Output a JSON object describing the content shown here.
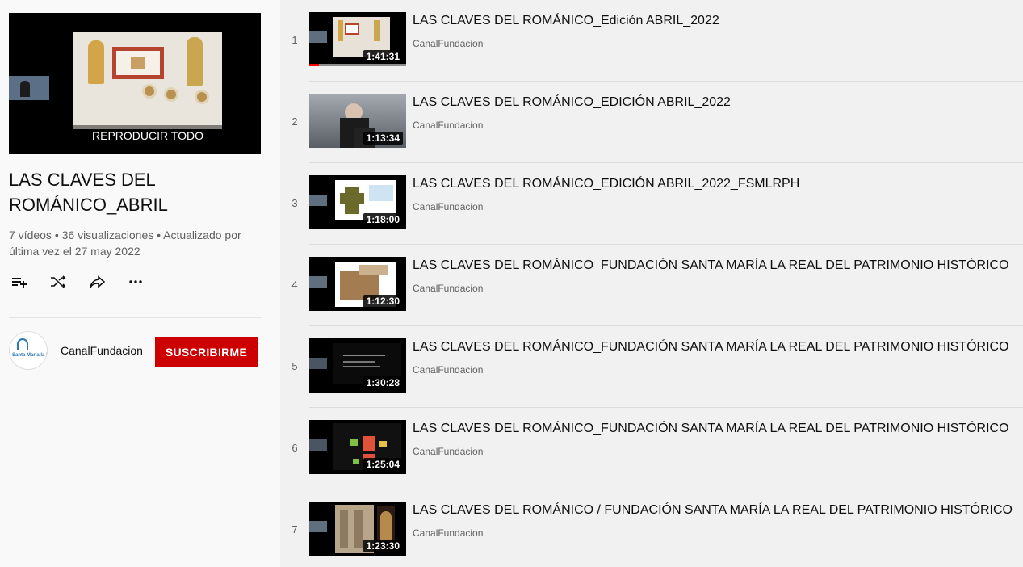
{
  "playlist": {
    "play_all_label": "REPRODUCIR TODO",
    "title": "LAS CLAVES DEL ROMÁNICO_ABRIL",
    "meta": "7 vídeos • 36 visualizaciones • Actualizado por última vez el 27 may 2022",
    "actions": [
      "add-to-queue-icon",
      "shuffle-icon",
      "share-icon",
      "more-icon"
    ],
    "owner": {
      "name": "CanalFundacion",
      "avatar_text": "Santa María la Real",
      "subscribe_label": "SUSCRIBIRME"
    }
  },
  "videos": [
    {
      "index": "1",
      "title": "LAS CLAVES DEL ROMÁNICO_Edición ABRIL_2022",
      "channel": "CanalFundacion",
      "duration": "1:41:31",
      "watched_fraction": 0.1
    },
    {
      "index": "2",
      "title": "LAS CLAVES DEL ROMÁNICO_EDICIÓN ABRIL_2022",
      "channel": "CanalFundacion",
      "duration": "1:13:34"
    },
    {
      "index": "3",
      "title": "LAS CLAVES DEL ROMÁNICO_EDICIÓN ABRIL_2022_FSMLRPH",
      "channel": "CanalFundacion",
      "duration": "1:18:00"
    },
    {
      "index": "4",
      "title": "LAS CLAVES DEL ROMÁNICO_FUNDACIÓN SANTA MARÍA LA REAL DEL PATRIMONIO HISTÓRICO",
      "channel": "CanalFundacion",
      "duration": "1:12:30"
    },
    {
      "index": "5",
      "title": "LAS CLAVES DEL ROMÁNICO_FUNDACIÓN SANTA MARÍA LA REAL DEL PATRIMONIO HISTÓRICO",
      "channel": "CanalFundacion",
      "duration": "1:30:28"
    },
    {
      "index": "6",
      "title": "LAS CLAVES DEL ROMÁNICO_FUNDACIÓN SANTA MARÍA LA REAL DEL PATRIMONIO HISTÓRICO",
      "channel": "CanalFundacion",
      "duration": "1:25:04"
    },
    {
      "index": "7",
      "title": "LAS CLAVES DEL ROMÁNICO / FUNDACIÓN SANTA MARÍA LA REAL DEL PATRIMONIO HISTÓRICO",
      "channel": "CanalFundacion",
      "duration": "1:23:30"
    }
  ],
  "colors": {
    "subscribe": "#cc0000",
    "progress": "#ff0000",
    "meta_text": "#606060"
  }
}
